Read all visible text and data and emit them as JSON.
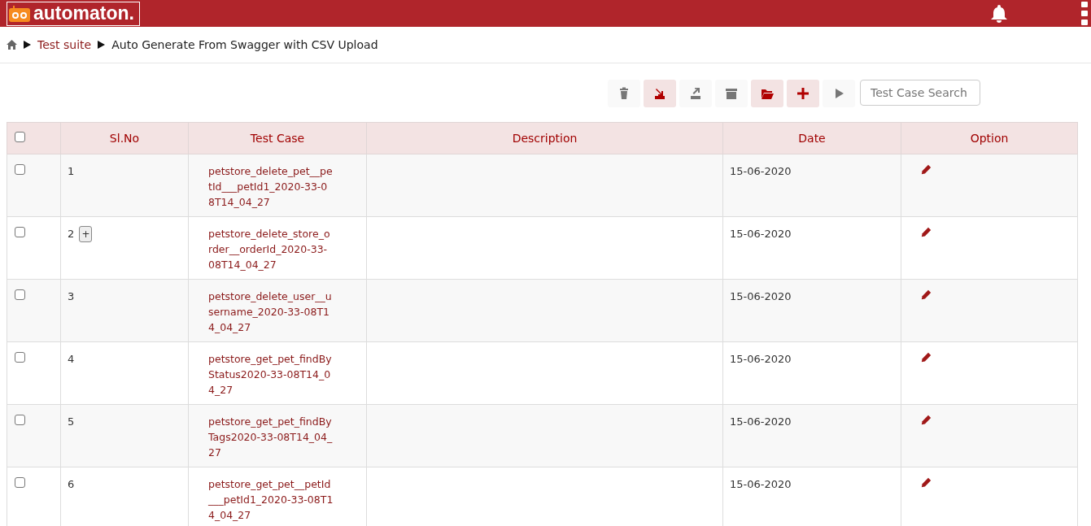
{
  "header": {
    "logo_text": "automaton."
  },
  "breadcrumb": {
    "items": [
      "Test suite",
      "Auto Generate From Swagger with CSV Upload"
    ]
  },
  "toolbar": {
    "buttons": [
      {
        "kind": "delete",
        "enabled": false
      },
      {
        "kind": "import",
        "enabled": true
      },
      {
        "kind": "export",
        "enabled": false
      },
      {
        "kind": "archive",
        "enabled": false
      },
      {
        "kind": "folder",
        "enabled": true
      },
      {
        "kind": "add",
        "enabled": true
      },
      {
        "kind": "run",
        "enabled": false
      }
    ],
    "search": {
      "placeholder": "Test Case Search"
    }
  },
  "table": {
    "select_all_checked": false,
    "columns": [
      "Sl.No",
      "Test Case",
      "Description",
      "Date",
      "Option"
    ],
    "rows": [
      {
        "checked": false,
        "sl_no": "1",
        "test_case": "petstore_delete_pet__petId___petId1_2020-33-08T14_04_27",
        "date": "15-06-2020"
      },
      {
        "checked": false,
        "sl_no": "2",
        "expand_label": "+",
        "test_case": "petstore_delete_store_order__orderId_2020-33-08T14_04_27",
        "date": "15-06-2020"
      },
      {
        "checked": false,
        "sl_no": "3",
        "test_case": "petstore_delete_user__username_2020-33-08T14_04_27",
        "date": "15-06-2020"
      },
      {
        "checked": false,
        "sl_no": "4",
        "test_case": "petstore_get_pet_findByStatus2020-33-08T14_04_27",
        "date": "15-06-2020"
      },
      {
        "checked": false,
        "sl_no": "5",
        "test_case": "petstore_get_pet_findByTags2020-33-08T14_04_27",
        "date": "15-06-2020"
      },
      {
        "checked": false,
        "sl_no": "6",
        "test_case": "petstore_get_pet__petId___petId1_2020-33-08T14_04_27",
        "date": "15-06-2020"
      }
    ]
  }
}
